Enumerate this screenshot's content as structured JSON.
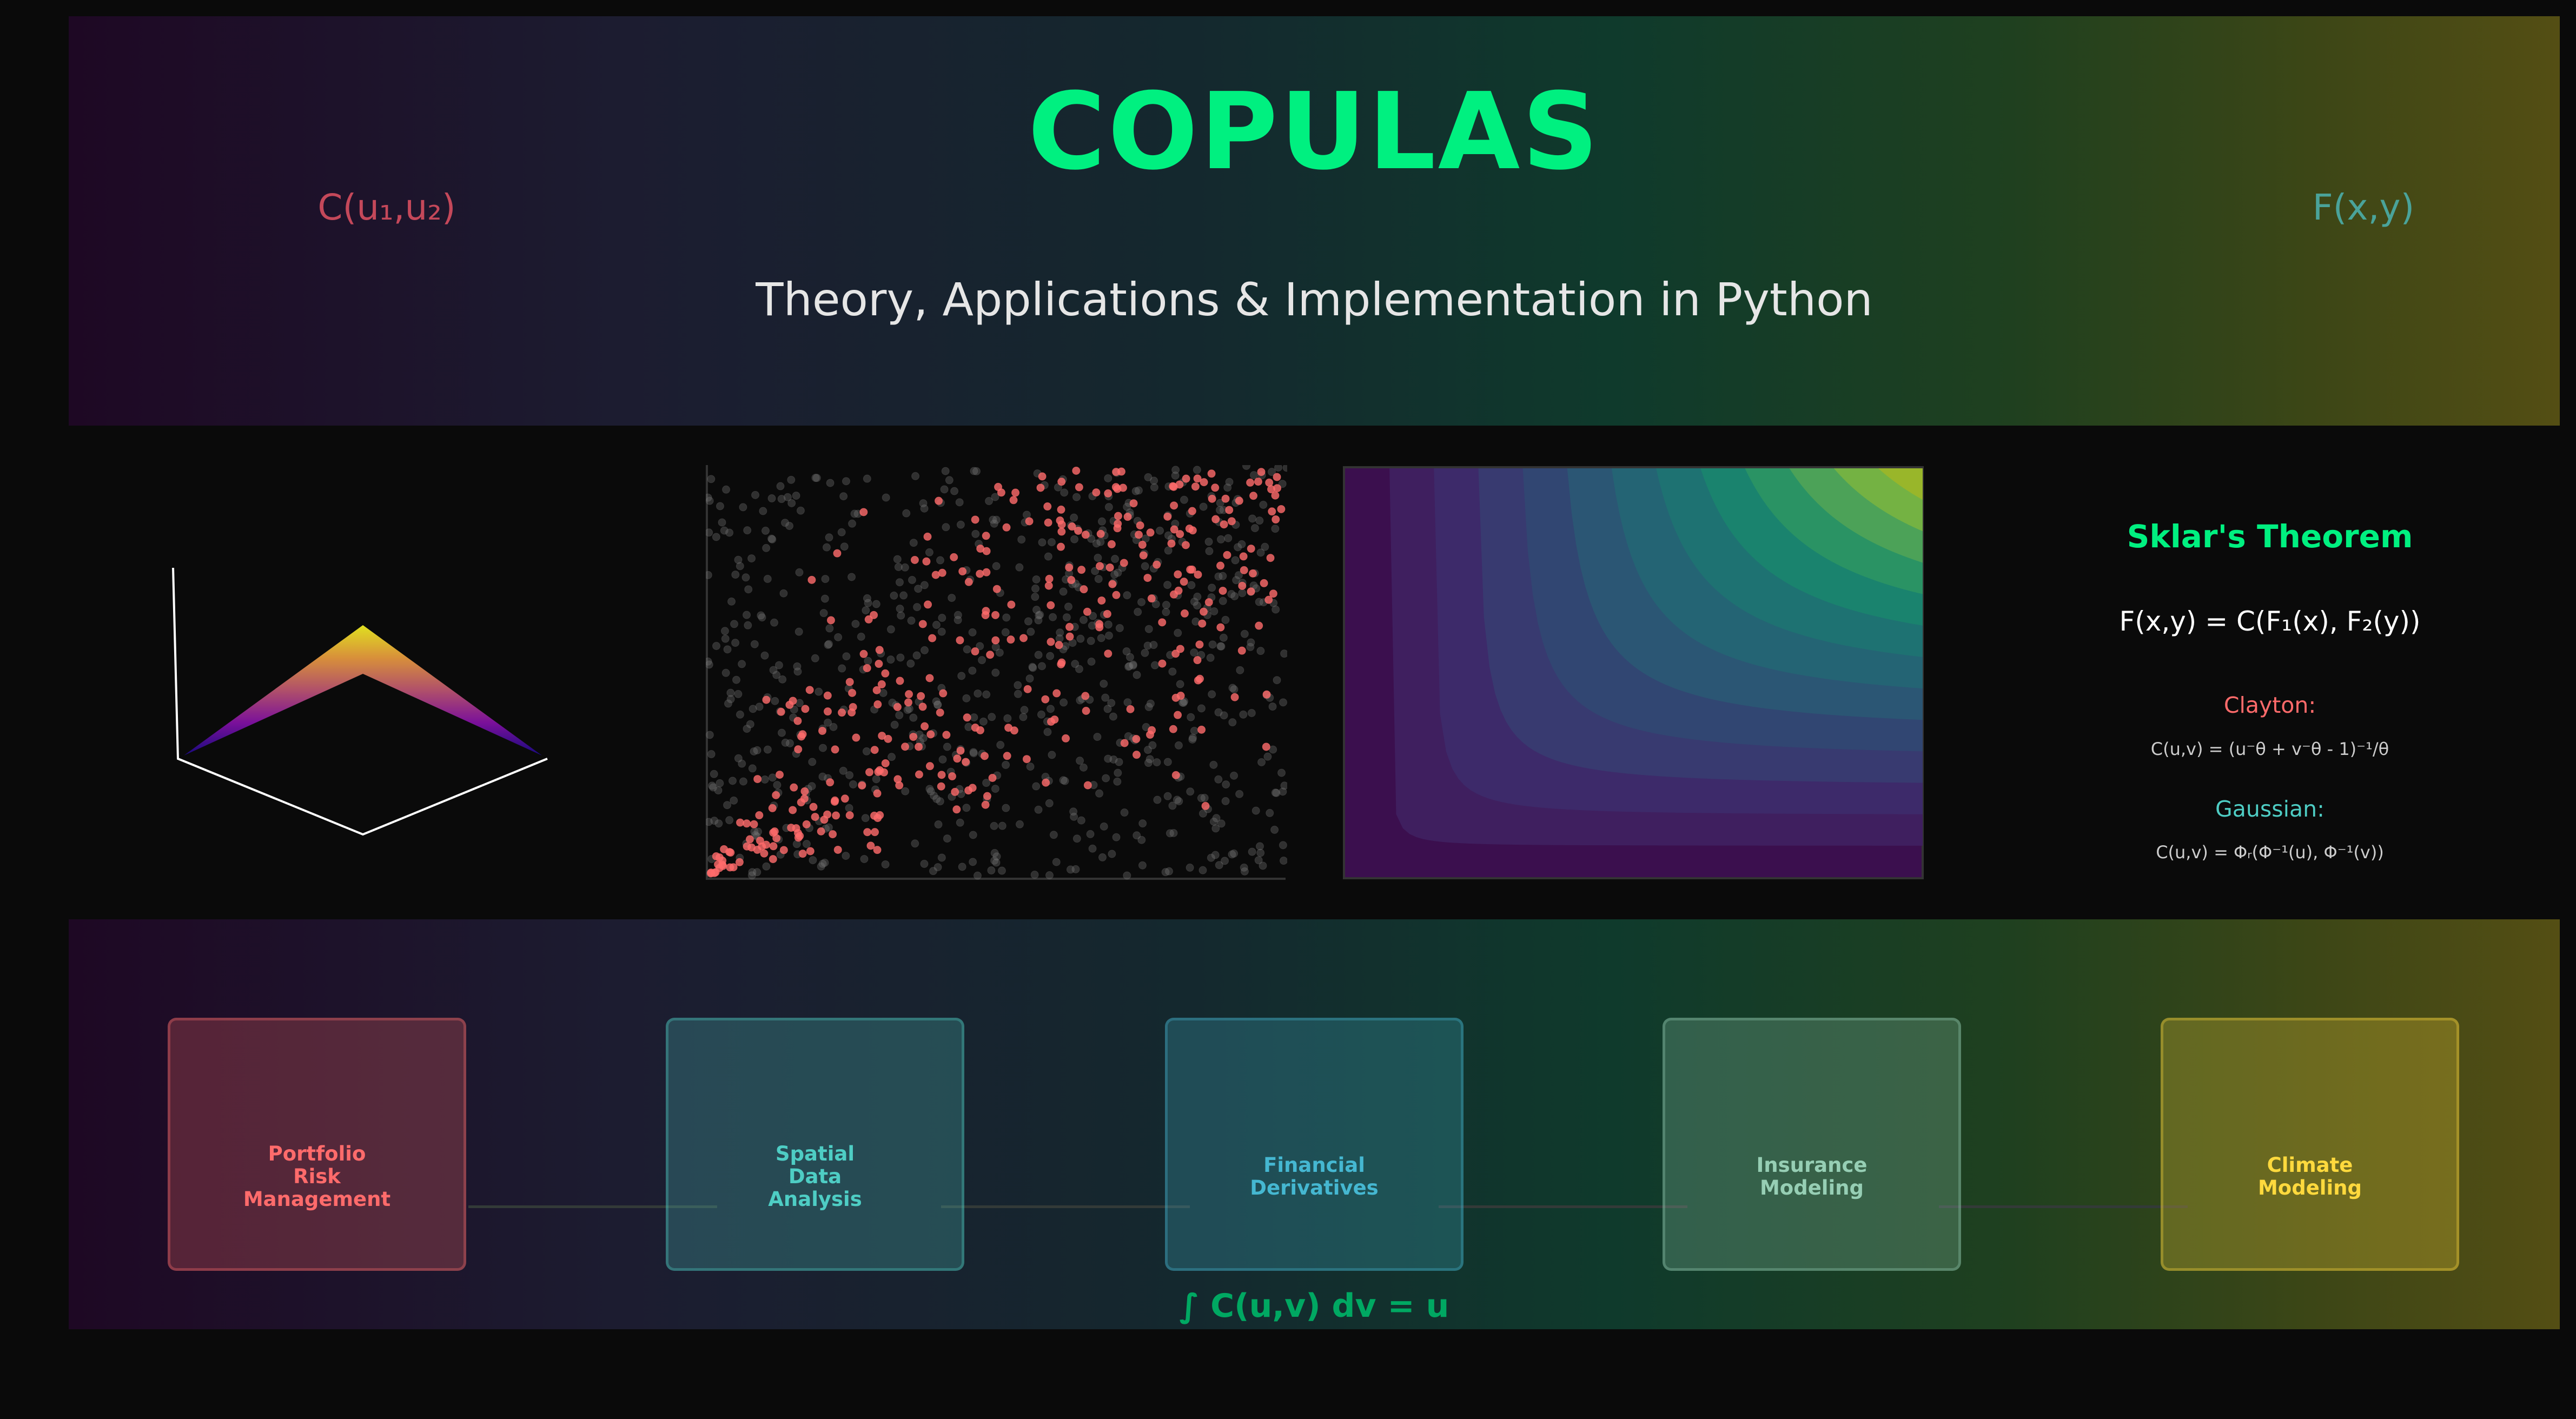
{
  "header": {
    "title": "COPULAS",
    "subtitle": "Theory, Applications & Implementation in Python",
    "left_formula": "C(u₁,u₂)",
    "right_formula": "F(x,y)"
  },
  "sklar": {
    "title": "Sklar's Theorem",
    "formula": "F(x,y) = C(F₁(x), F₂(y))",
    "clayton_label": "Clayton:",
    "clayton_formula": "C(u,v) = (u⁻θ + v⁻θ - 1)⁻¹/θ",
    "gaussian_label": "Gaussian:",
    "gaussian_formula": "C(u,v) = Φᵣ(Φ⁻¹(u), Φ⁻¹(v))"
  },
  "applications": [
    {
      "label": "Portfolio\nRisk\nManagement",
      "color": "#ff6b6b"
    },
    {
      "label": "Spatial\nData\nAnalysis",
      "color": "#4ecdc4"
    },
    {
      "label": "Financial\nDerivatives",
      "color": "#45b7d1"
    },
    {
      "label": "Insurance\nModeling",
      "color": "#96ceb4"
    },
    {
      "label": "Climate\nModeling",
      "color": "#ffd93d"
    }
  ],
  "footer_formula": "∫ C(u,v) dv = u",
  "colors": {
    "accent": "#00f080",
    "red": "#ff6b6b",
    "teal": "#4ecdc4"
  }
}
